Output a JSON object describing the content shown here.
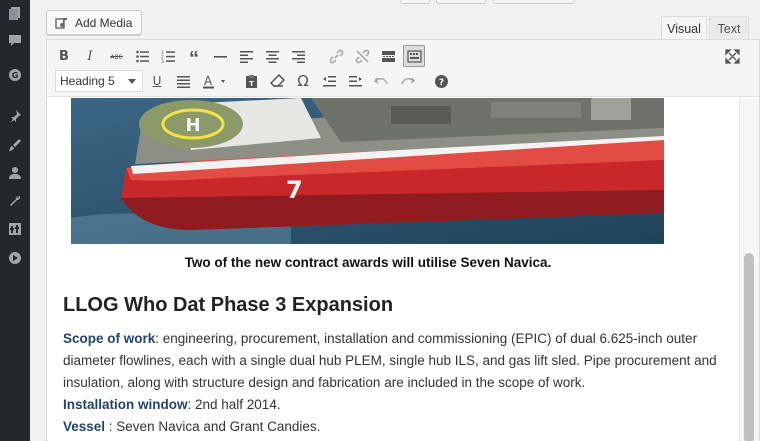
{
  "sidebar": {
    "items": [
      {
        "icon": "pages-icon"
      },
      {
        "icon": "comments-icon"
      },
      {
        "icon": "g-circle-icon"
      },
      {
        "icon": "pushpin-icon"
      },
      {
        "icon": "appearance-icon"
      },
      {
        "icon": "users-icon"
      },
      {
        "icon": "tools-icon"
      },
      {
        "icon": "settings-icon"
      },
      {
        "icon": "play-icon"
      }
    ]
  },
  "toolbar": {
    "add_media_label": "Add Media",
    "format_select_value": "Heading 5"
  },
  "tabs": {
    "visual": "Visual",
    "text": "Text",
    "active": "Visual"
  },
  "content": {
    "caption": "Two of the new contract awards will utilise Seven Navica.",
    "section_title": "LLOG Who Dat Phase 3 Expansion",
    "scope_label": "Scope of work",
    "scope_text": ": engineering, procurement, installation and commissioning (EPIC) of dual 6.625-inch outer diameter flowlines, each with a single dual hub PLEM, single hub ILS, and gas lift sled. Pipe procurement and insulation, along with structure design and fabrication are included in the scope of work.",
    "window_label": "Installation window",
    "window_text": ": 2nd half 2014.",
    "vessel_label": "Vessel",
    "vessel_text": " : Seven Navica and Grant Candies."
  },
  "colors": {
    "sidebar_bg": "#23282d",
    "label_blue": "#23456b",
    "ship_red": "#c8282a",
    "sea": "#2e5670"
  }
}
